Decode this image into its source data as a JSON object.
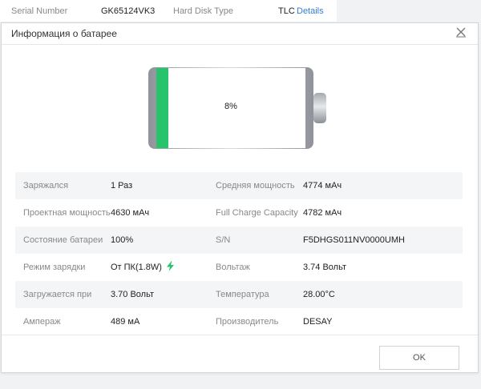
{
  "background_window": {
    "serial_label": "Serial Number",
    "serial_value": "GK65124VK3",
    "disk_type_label": "Hard Disk Type",
    "disk_type_value": "TLC",
    "details_link": "Details"
  },
  "dialog": {
    "title": "Информация о батарее",
    "close_icon": "close-icon",
    "ok_label": "OK"
  },
  "battery": {
    "percent_text": "8%",
    "level": 0.08,
    "fill_color": "#27c46b"
  },
  "info_rows": [
    {
      "label1": "Заряжался",
      "value1": "1 Раз",
      "label2": "Средняя мощность",
      "value2": "4774 мАч"
    },
    {
      "label1": "Проектная мощность",
      "value1": "4630 мАч",
      "label2": "Full Charge Capacity",
      "value2": "4782 мАч"
    },
    {
      "label1": "Состояние батареи",
      "value1": "100%",
      "label2": "S/N",
      "value2": "F5DHGS011NV0000UMH"
    },
    {
      "label1": "Режим зарядки",
      "value1": "От ПК(1.8W)",
      "label2": "Вольтаж",
      "value2": "3.74 Вольт",
      "icon": "lightning-bolt-icon"
    },
    {
      "label1": "Загружается при",
      "value1": "3.70 Вольт",
      "label2": "Температура",
      "value2": "28.00°C"
    },
    {
      "label1": "Ампераж",
      "value1": "489 мА",
      "label2": "Производитель",
      "value2": "DESAY"
    }
  ],
  "colors": {
    "accent_green": "#27c46b",
    "link_blue": "#2f7fd6"
  }
}
